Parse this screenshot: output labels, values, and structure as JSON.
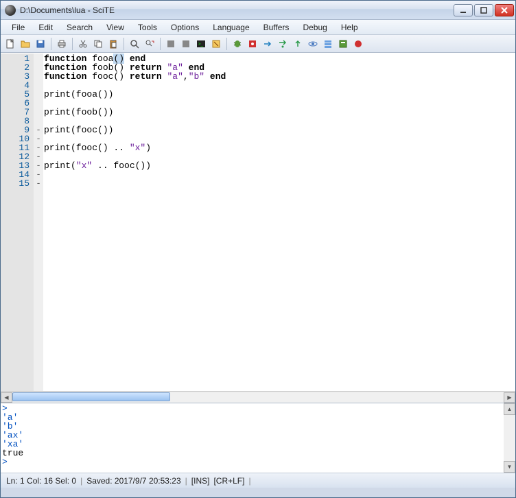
{
  "window": {
    "title": "D:\\Documents\\lua - SciTE"
  },
  "menu": {
    "file": "File",
    "edit": "Edit",
    "search": "Search",
    "view": "View",
    "tools": "Tools",
    "options": "Options",
    "language": "Language",
    "buffers": "Buffers",
    "debug": "Debug",
    "help": "Help"
  },
  "gutter": {
    "lines": [
      "1",
      "2",
      "3",
      "4",
      "5",
      "6",
      "7",
      "8",
      "9",
      "10",
      "11",
      "12",
      "13",
      "14",
      "15"
    ]
  },
  "fold": {
    "marks": [
      "",
      "",
      "",
      "",
      "",
      "",
      "",
      "",
      "-",
      "-",
      "-",
      "-",
      "-",
      "-",
      "-"
    ]
  },
  "code": {
    "l1a": "function",
    "l1b": " fooa",
    "l1c": "()",
    "l1d": " end",
    "l2a": "function",
    "l2b": " foob() ",
    "l2c": "return",
    "l2d": " ",
    "l2e": "\"a\"",
    "l2f": " end",
    "l3a": "function",
    "l3b": " fooc() ",
    "l3c": "return",
    "l3d": " ",
    "l3e": "\"a\"",
    "l3f": ",",
    "l3g": "\"b\"",
    "l3h": " end",
    "l5": "print(fooa())",
    "l7": "print(foob())",
    "l9": "print(fooc())",
    "l11a": "print(fooc() .. ",
    "l11b": "\"x\"",
    "l11c": ")",
    "l13a": "print(",
    "l13b": "\"x\"",
    "l13c": " .. fooc())"
  },
  "output": {
    "l1": "> ",
    "l2": "'a'",
    "l3": "'b'",
    "l4": "'ax'",
    "l5": "'xa'",
    "l6": "true",
    "l7": ">"
  },
  "status": {
    "pos": "Ln: 1 Col: 16 Sel: 0",
    "saved": "Saved: 2017/9/7  20:53:23",
    "ins": "[INS]",
    "eol": "[CR+LF]"
  }
}
